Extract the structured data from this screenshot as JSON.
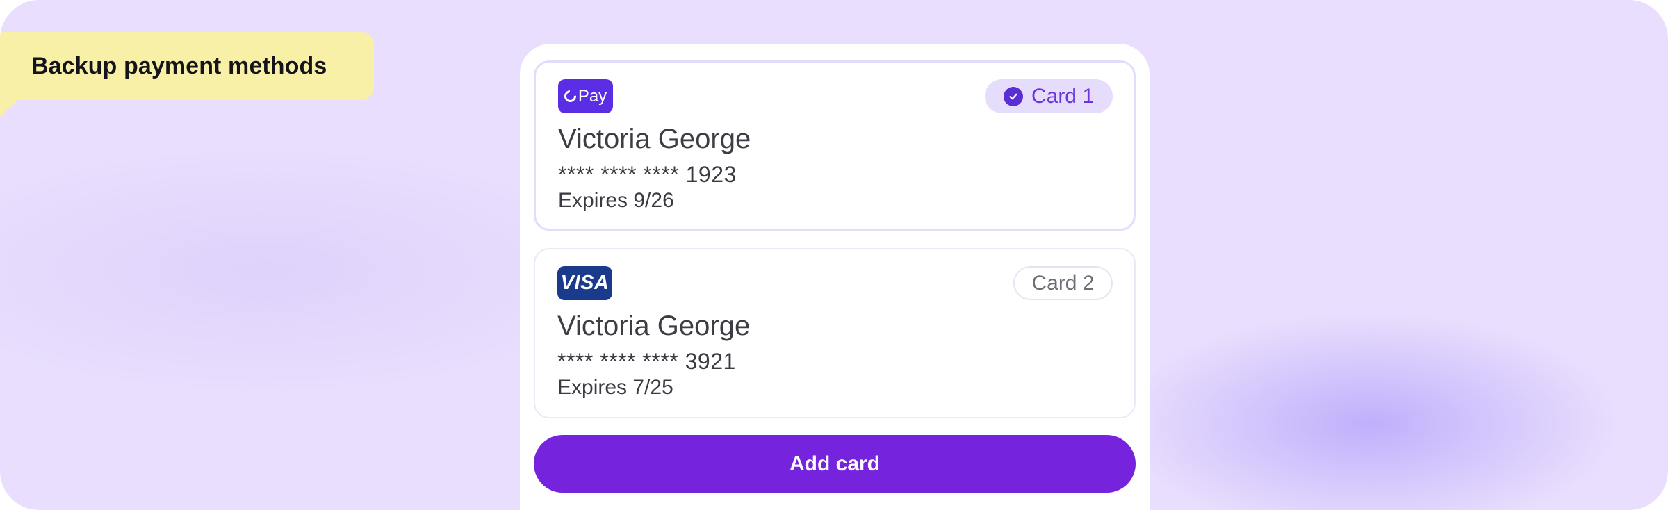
{
  "callout": {
    "label": "Backup payment methods"
  },
  "cards": [
    {
      "brand_label": "Pay",
      "brand_icon": "opay-logo",
      "badge_label": "Card 1",
      "selected": true,
      "holder": "Victoria George",
      "number": "**** **** **** 1923",
      "expiry": "Expires 9/26"
    },
    {
      "brand_label": "VISA",
      "brand_icon": "visa-logo",
      "badge_label": "Card 2",
      "selected": false,
      "holder": "Victoria George",
      "number": "**** **** **** 3921",
      "expiry": "Expires 7/25"
    }
  ],
  "actions": {
    "add_card_label": "Add card"
  },
  "colors": {
    "accent": "#7523dc",
    "background": "#e9defd",
    "callout": "#f8f0a6",
    "selected_badge": "#e6dcfc"
  }
}
